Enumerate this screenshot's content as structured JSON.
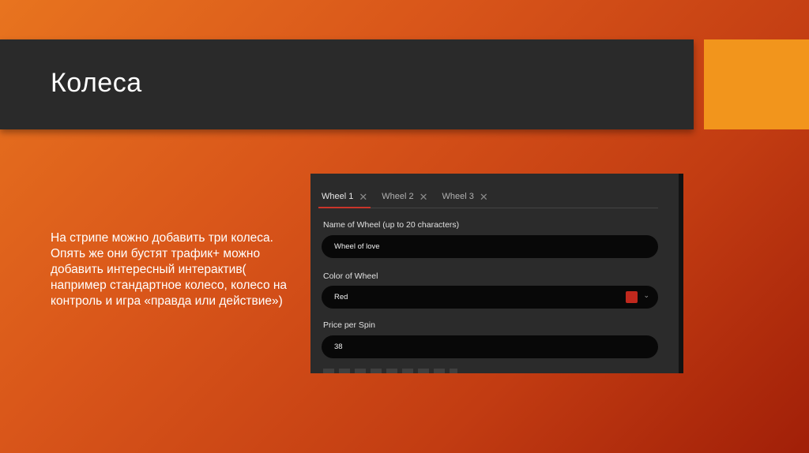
{
  "slide": {
    "title": "Колеса",
    "body": "На стрипе можно добавить три колеса. Опять же они бустят трафик+ можно добавить интересный интерактив( например стандартное колесо, колесо на контроль и игра «правда или действие»)",
    "colors": {
      "title_band": "#2a2a2a",
      "accent": "#f2951c",
      "background_start": "#e8741f",
      "background_end": "#a11f08"
    }
  },
  "wheel_ui": {
    "tabs": [
      {
        "label": "Wheel 1",
        "active": true,
        "icon": "close-icon"
      },
      {
        "label": "Wheel 2",
        "active": false,
        "icon": "close-icon"
      },
      {
        "label": "Wheel 3",
        "active": false,
        "icon": "close-icon"
      }
    ],
    "name": {
      "label": "Name of Wheel (up to 20 characters)",
      "value": "Wheel of love"
    },
    "color": {
      "label": "Color of Wheel",
      "value": "Red",
      "swatch": "#c0281d",
      "icon": "chevron-down-icon"
    },
    "price": {
      "label": "Price per Spin",
      "value": "38"
    },
    "tab_accent": "#c9352a"
  }
}
